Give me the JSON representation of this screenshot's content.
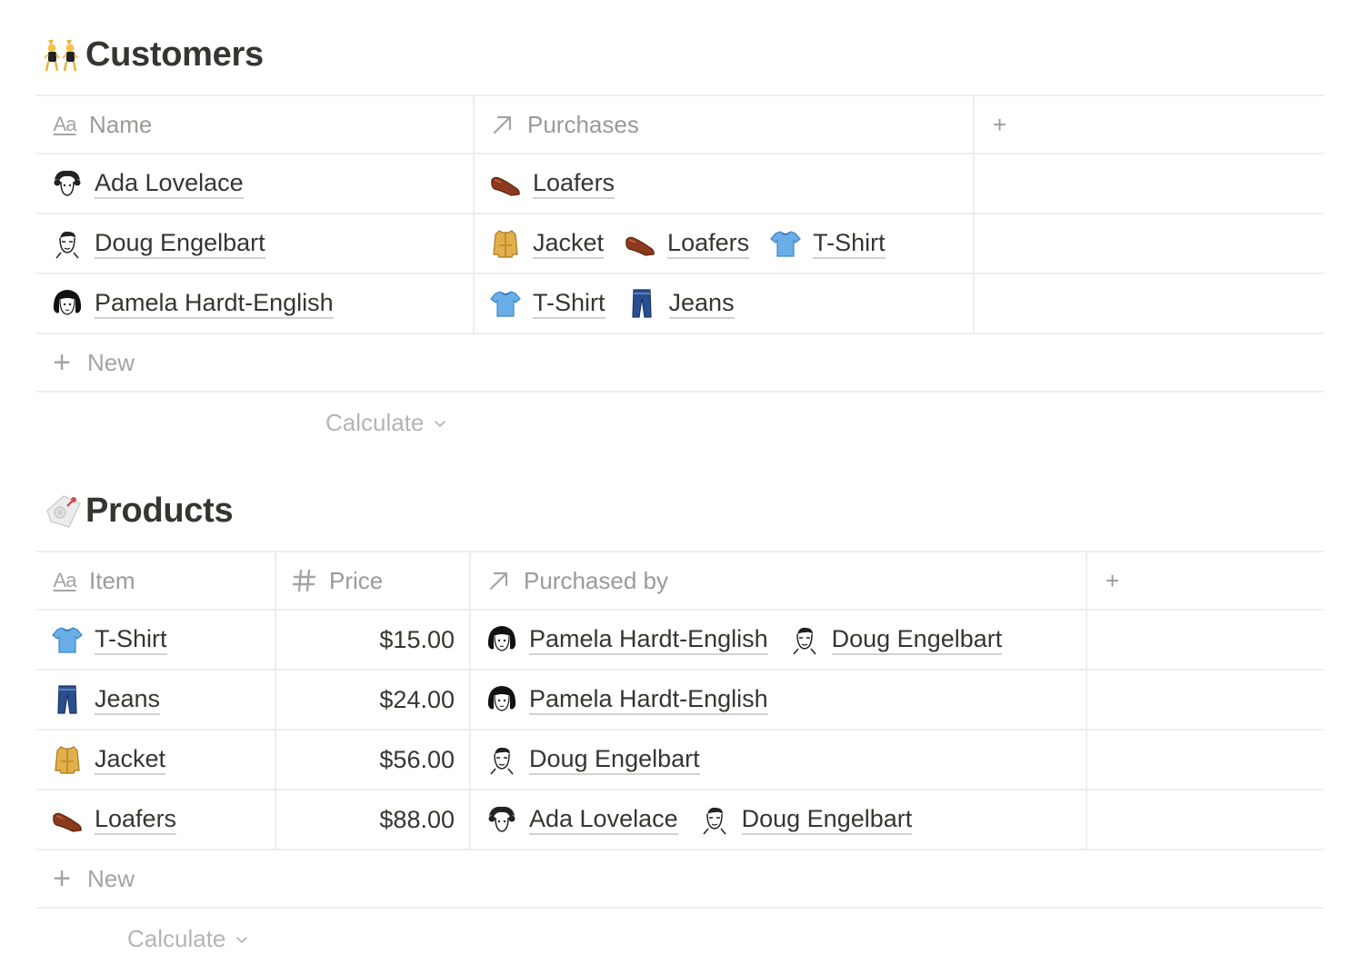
{
  "customers": {
    "title": "Customers",
    "title_icon": "dancers-icon",
    "columns": [
      {
        "label": "Name",
        "icon": "title-property-icon"
      },
      {
        "label": "Purchases",
        "icon": "relation-arrow-icon"
      }
    ],
    "add_column_label": "+",
    "rows": [
      {
        "name": "Ada Lovelace",
        "avatar": "ada-avatar-icon",
        "purchases": [
          {
            "label": "Loafers",
            "icon": "loafer-icon"
          }
        ]
      },
      {
        "name": "Doug Engelbart",
        "avatar": "doug-avatar-icon",
        "purchases": [
          {
            "label": "Jacket",
            "icon": "jacket-icon"
          },
          {
            "label": "Loafers",
            "icon": "loafer-icon"
          },
          {
            "label": "T-Shirt",
            "icon": "tshirt-icon"
          }
        ]
      },
      {
        "name": "Pamela Hardt-English",
        "avatar": "pamela-avatar-icon",
        "purchases": [
          {
            "label": "T-Shirt",
            "icon": "tshirt-icon"
          },
          {
            "label": "Jeans",
            "icon": "jeans-icon"
          }
        ]
      }
    ],
    "new_label": "New",
    "calculate_label": "Calculate"
  },
  "products": {
    "title": "Products",
    "title_icon": "label-tag-icon",
    "columns": [
      {
        "label": "Item",
        "icon": "title-property-icon"
      },
      {
        "label": "Price",
        "icon": "number-hash-icon"
      },
      {
        "label": "Purchased by",
        "icon": "relation-arrow-icon"
      }
    ],
    "add_column_label": "+",
    "rows": [
      {
        "item": "T-Shirt",
        "icon": "tshirt-icon",
        "price": "$15.00",
        "purchased_by": [
          {
            "label": "Pamela Hardt-English",
            "icon": "pamela-avatar-icon"
          },
          {
            "label": "Doug Engelbart",
            "icon": "doug-avatar-icon"
          }
        ]
      },
      {
        "item": "Jeans",
        "icon": "jeans-icon",
        "price": "$24.00",
        "purchased_by": [
          {
            "label": "Pamela Hardt-English",
            "icon": "pamela-avatar-icon"
          }
        ]
      },
      {
        "item": "Jacket",
        "icon": "jacket-icon",
        "price": "$56.00",
        "purchased_by": [
          {
            "label": "Doug Engelbart",
            "icon": "doug-avatar-icon"
          }
        ]
      },
      {
        "item": "Loafers",
        "icon": "loafer-icon",
        "price": "$88.00",
        "purchased_by": [
          {
            "label": "Ada Lovelace",
            "icon": "ada-avatar-icon"
          },
          {
            "label": "Doug Engelbart",
            "icon": "doug-avatar-icon"
          }
        ]
      }
    ],
    "new_label": "New",
    "calculate_label": "Calculate"
  },
  "colors": {
    "text": "#37352f",
    "muted": "#9b9a97",
    "border": "#ededec",
    "link_underline": "#d3d2cf"
  }
}
